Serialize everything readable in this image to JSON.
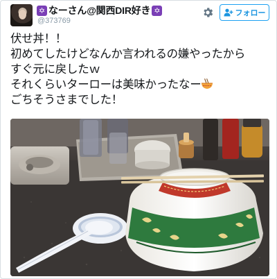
{
  "tweet": {
    "star_left": "✡",
    "display_name": "なーさん@関西DIR好き",
    "star_right": "✡",
    "handle": "@373769",
    "follow_label": "フォロー",
    "follow_icon": "follow-person-plus-icon",
    "settings_icon": "gear-icon",
    "lines": [
      "伏せ丼！！",
      "初めてしたけどなんか言われるの嫌やったから",
      "すぐ元に戻したｗ",
      "それくらいターローは美味かったなー",
      "ごちそうさまでした！"
    ],
    "emoji": "ramen-bowl-icon"
  },
  "colors": {
    "follow_blue": "#1da1f2",
    "star_purple": "#7a3fb6",
    "handle_gray": "#8899a6",
    "bowl_green": "#2e7a3e",
    "bowl_red": "#c0392b"
  }
}
